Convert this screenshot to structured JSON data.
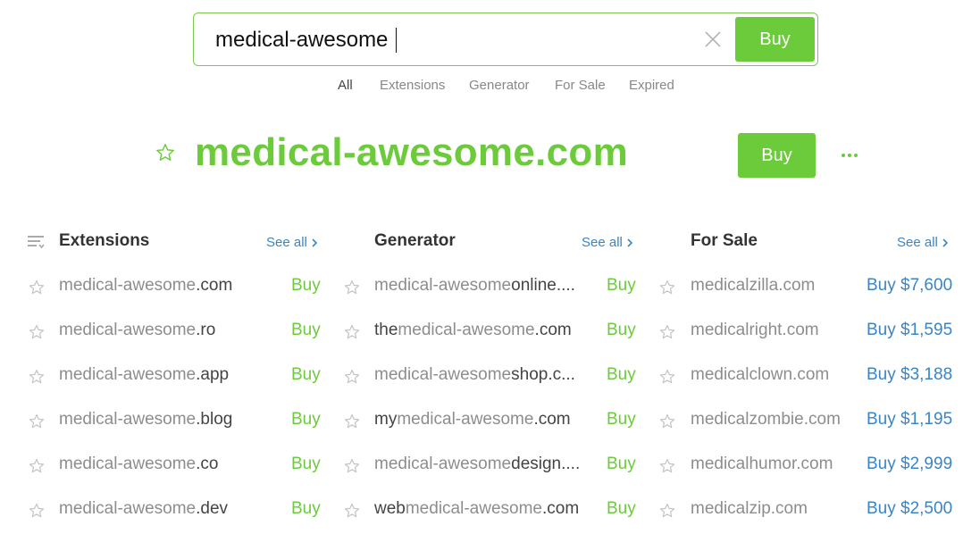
{
  "search": {
    "value": "medical-awesome",
    "buy_label": "Buy",
    "clear_icon": "close-icon"
  },
  "tabs": [
    {
      "label": "All",
      "active": true
    },
    {
      "label": "Extensions",
      "active": false
    },
    {
      "label": "Generator",
      "active": false
    },
    {
      "label": "For Sale",
      "active": false
    },
    {
      "label": "Expired",
      "active": false
    }
  ],
  "hero": {
    "domain": "medical-awesome.com",
    "buy_label": "Buy",
    "star_icon": "star-outline-icon",
    "more_icon": "more-dots-icon"
  },
  "colors": {
    "green": "#6ccb3a",
    "blue": "#3a85c5",
    "gray_text": "#8d8d8d",
    "dark_text": "#444444"
  },
  "extensions": {
    "title": "Extensions",
    "see_all": "See all",
    "rows": [
      {
        "prefix": "",
        "base": "medical-awesome",
        "suffix": ".com",
        "buy": "Buy"
      },
      {
        "prefix": "",
        "base": "medical-awesome",
        "suffix": ".ro",
        "buy": "Buy"
      },
      {
        "prefix": "",
        "base": "medical-awesome",
        "suffix": ".app",
        "buy": "Buy"
      },
      {
        "prefix": "",
        "base": "medical-awesome",
        "suffix": ".blog",
        "buy": "Buy"
      },
      {
        "prefix": "",
        "base": "medical-awesome",
        "suffix": ".co",
        "buy": "Buy"
      },
      {
        "prefix": "",
        "base": "medical-awesome",
        "suffix": ".dev",
        "buy": "Buy"
      }
    ]
  },
  "generator": {
    "title": "Generator",
    "see_all": "See all",
    "rows": [
      {
        "prefix": "",
        "base": "medical-awesome",
        "suffix": "online....",
        "buy": "Buy"
      },
      {
        "prefix": "the",
        "base": "medical-awesome",
        "suffix": ".com",
        "buy": "Buy"
      },
      {
        "prefix": "",
        "base": "medical-awesome",
        "suffix": "shop.c...",
        "buy": "Buy"
      },
      {
        "prefix": "my",
        "base": "medical-awesome",
        "suffix": ".com",
        "buy": "Buy"
      },
      {
        "prefix": "",
        "base": "medical-awesome",
        "suffix": "design....",
        "buy": "Buy"
      },
      {
        "prefix": "web",
        "base": "medical-awesome",
        "suffix": ".com",
        "buy": "Buy"
      }
    ]
  },
  "forsale": {
    "title": "For Sale",
    "see_all": "See all",
    "rows": [
      {
        "domain": "medicalzilla.com",
        "buy": "Buy $7,600"
      },
      {
        "domain": "medicalright.com",
        "buy": "Buy $1,595"
      },
      {
        "domain": "medicalclown.com",
        "buy": "Buy $3,188"
      },
      {
        "domain": "medicalzombie.com",
        "buy": "Buy $1,195"
      },
      {
        "domain": "medicalhumor.com",
        "buy": "Buy $2,999"
      },
      {
        "domain": "medicalzip.com",
        "buy": "Buy $2,500"
      }
    ]
  }
}
